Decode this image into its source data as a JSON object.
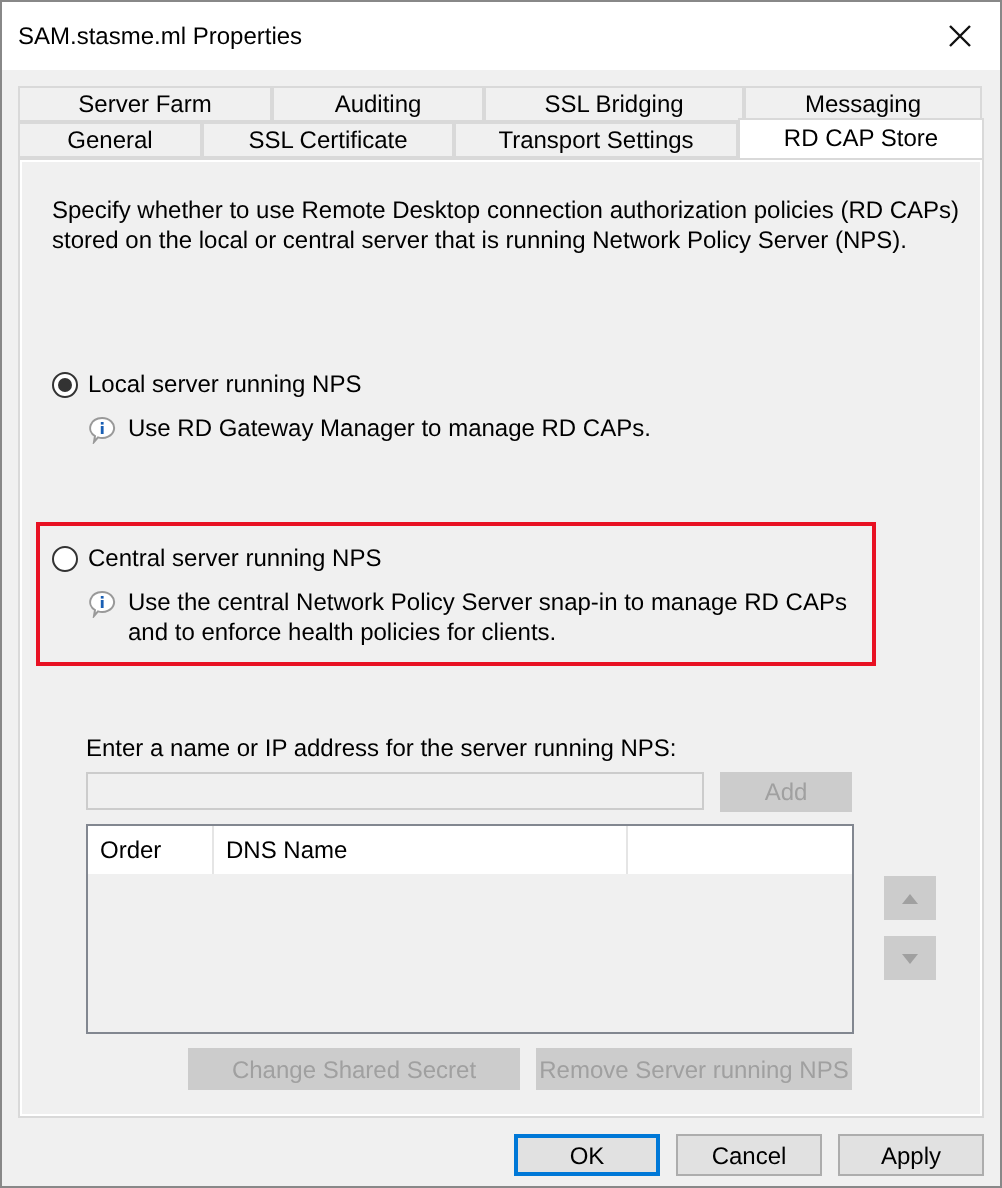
{
  "window": {
    "title": "SAM.stasme.ml Properties"
  },
  "tab_rows": [
    [
      {
        "label": "Server Farm",
        "selected": false
      },
      {
        "label": "Auditing",
        "selected": false
      },
      {
        "label": "SSL Bridging",
        "selected": false
      },
      {
        "label": "Messaging",
        "selected": false
      }
    ],
    [
      {
        "label": "General",
        "selected": false
      },
      {
        "label": "SSL Certificate",
        "selected": false
      },
      {
        "label": "Transport Settings",
        "selected": false
      },
      {
        "label": "RD CAP Store",
        "selected": true
      }
    ]
  ],
  "description": "Specify whether to use Remote Desktop connection authorization policies (RD CAPs) stored on the local or central server that is running Network Policy Server (NPS).",
  "options": [
    {
      "label": "Local server running NPS",
      "selected": true,
      "highlighted": false,
      "info": "Use RD Gateway Manager to manage RD CAPs."
    },
    {
      "label": "Central server running NPS",
      "selected": false,
      "highlighted": true,
      "info": "Use the central Network Policy Server snap-in to manage RD CAPs and to enforce health policies for clients."
    }
  ],
  "server_field": {
    "label": "Enter a name or IP address for the server running NPS:",
    "disabled": true
  },
  "add_button": {
    "label": "Add",
    "disabled": true
  },
  "server_list": {
    "columns": [
      "Order",
      "DNS Name"
    ]
  },
  "move_buttons": [
    {
      "kind": "up",
      "disabled": true
    },
    {
      "kind": "down",
      "disabled": true
    }
  ],
  "list_buttons": [
    {
      "label": "Change Shared Secret",
      "disabled": true
    },
    {
      "label": "Remove Server running NPS",
      "disabled": true
    }
  ],
  "dialog_buttons": [
    {
      "label": "OK",
      "default": true
    },
    {
      "label": "Cancel",
      "default": false
    },
    {
      "label": "Apply",
      "default": false
    }
  ]
}
